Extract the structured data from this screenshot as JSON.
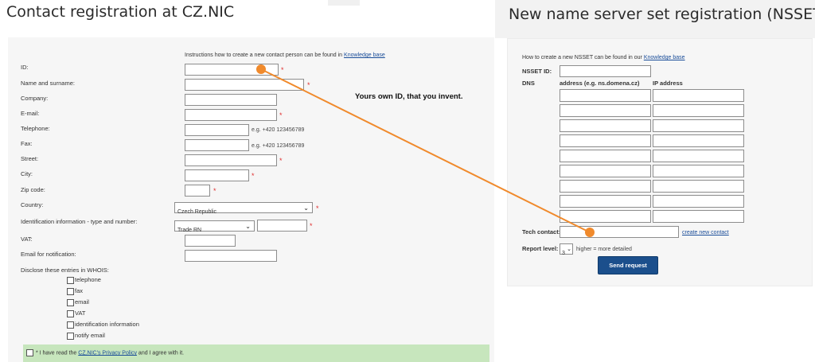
{
  "left": {
    "title": "Contact registration at CZ.NIC",
    "instructions_prefix": "Instructions how to create a new contact person can be found in",
    "instructions_link": "Knowledge base",
    "fields": {
      "id": "ID:",
      "name": "Name and surname:",
      "company": "Company:",
      "email": "E-mail:",
      "telephone": "Telephone:",
      "fax": "Fax:",
      "street": "Street:",
      "city": "City:",
      "zip": "Zip code:",
      "country": "Country:",
      "ident": "Identification information - type and number:",
      "vat": "VAT:",
      "notify": "Email for notification:",
      "disclose": "Disclose these entries in WHOIS:"
    },
    "required_mark": "*",
    "phone_hint": "e.g. +420 123456789",
    "fax_hint": "e.g. +420 123456789",
    "country_value": "Czech Republic",
    "ident_type_value": "Trade RN",
    "disclose_items": [
      "telephone",
      "fax",
      "email",
      "VAT",
      "identification information",
      "notify email"
    ],
    "privacy_prefix": "* I have read the",
    "privacy_link": "CZ.NIC's Privacy Policy",
    "privacy_suffix": "and I agree with it."
  },
  "annotation": {
    "text": "Yours own ID, that you invent.",
    "color": "#f08a2c"
  },
  "right": {
    "title": "New name server set registration (NSSET)",
    "howto_prefix": "How to create a new NSSET can be found in our",
    "howto_link": "Knowledge base",
    "nsset_id_label": "NSSET ID:",
    "dns_label": "DNS",
    "col_address": "address (e.g. ns.domena.cz)",
    "col_ip": "IP address",
    "tech_contact_label": "Tech contact:",
    "create_contact_link": "create new contact",
    "report_level_label": "Report level:",
    "report_level_value": "3",
    "report_hint": "higher = more detailed",
    "send_button": "Send request"
  }
}
